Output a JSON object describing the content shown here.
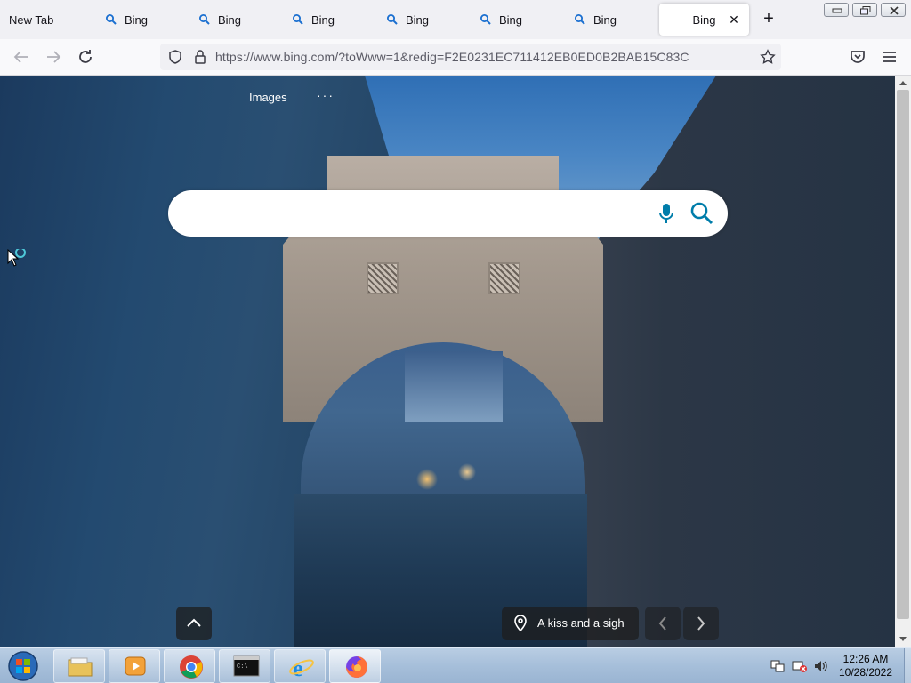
{
  "browser": {
    "tabs": [
      {
        "label": "New Tab",
        "icon": "none"
      },
      {
        "label": "Bing",
        "icon": "search-icon"
      },
      {
        "label": "Bing",
        "icon": "search-icon"
      },
      {
        "label": "Bing",
        "icon": "search-icon"
      },
      {
        "label": "Bing",
        "icon": "search-icon"
      },
      {
        "label": "Bing",
        "icon": "search-icon"
      },
      {
        "label": "Bing",
        "icon": "search-icon"
      },
      {
        "label": "Bing",
        "icon": "none",
        "active": true
      }
    ],
    "new_tab": "+",
    "url": "https://www.bing.com/?toWww=1&redig=F2E0231EC711412EB0ED0B2BAB15C83C"
  },
  "page": {
    "nav_images": "Images",
    "more": "···",
    "search_value": "",
    "caption": "A kiss and a sigh"
  },
  "taskbar": {
    "apps": [
      "file-explorer",
      "media-player",
      "chrome",
      "command-prompt",
      "internet-explorer",
      "firefox"
    ],
    "active_app": "firefox",
    "time": "12:26 AM",
    "date": "10/28/2022"
  },
  "colors": {
    "accent": "#007daa",
    "tab_bg": "#f0f0f4",
    "taskbar": "#a6bfda"
  }
}
